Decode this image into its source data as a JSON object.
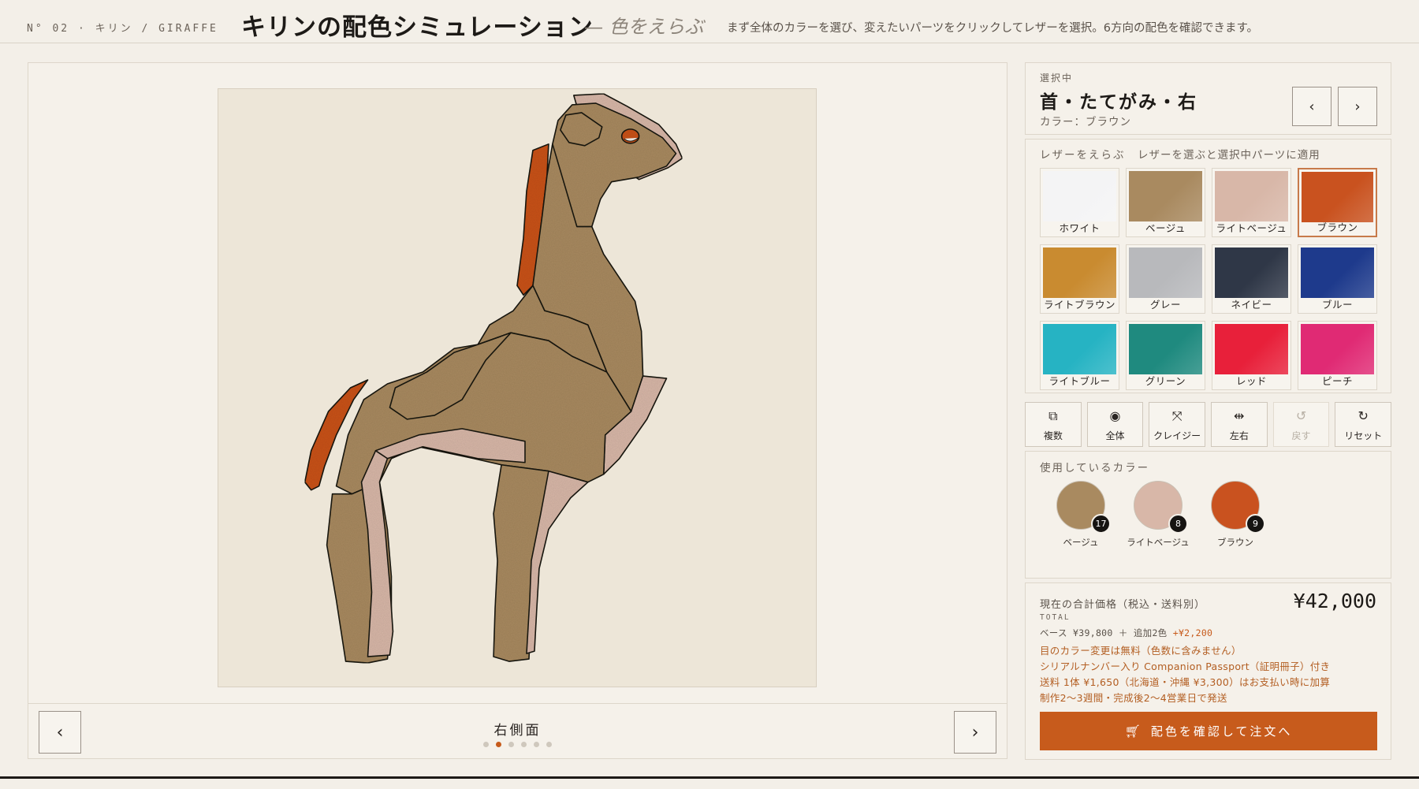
{
  "header": {
    "number": "N° 02 · キリン / GIRAFFE",
    "title": "キリンの配色シミュレーション",
    "subtitle": "— 色をえらぶ",
    "description": "まず全体のカラーを選び、変えたいパーツをクリックしてレザーを選択。6方向の配色を確認できます。"
  },
  "stage": {
    "view_label": "右側面",
    "prev_icon": "chevron-left-icon",
    "next_icon": "chevron-right-icon",
    "views_total": 6,
    "view_active_index": 1
  },
  "selection": {
    "caption": "選択中",
    "part_name": "首・たてがみ・右",
    "color_label": "カラー：ブラウン"
  },
  "leather": {
    "caption": "レザーをえらぶ",
    "hint": "レザーを選ぶと選択中パーツに適用",
    "swatches": [
      {
        "label": "ホワイト",
        "color": "#f4f4f5",
        "selected": false
      },
      {
        "label": "ベージュ",
        "color": "#a98a60",
        "selected": false
      },
      {
        "label": "ライトベージュ",
        "color": "#d8b7a8",
        "selected": false
      },
      {
        "label": "ブラウン",
        "color": "#c9521f",
        "selected": true
      },
      {
        "label": "ライトブラウン",
        "color": "#c98b30",
        "selected": false
      },
      {
        "label": "グレー",
        "color": "#b8b9bc",
        "selected": false
      },
      {
        "label": "ネイビー",
        "color": "#2f3747",
        "selected": false
      },
      {
        "label": "ブルー",
        "color": "#1e3a8c",
        "selected": false
      },
      {
        "label": "ライトブルー",
        "color": "#26b3c3",
        "selected": false
      },
      {
        "label": "グリーン",
        "color": "#1f8a7f",
        "selected": false
      },
      {
        "label": "レッド",
        "color": "#e8203a",
        "selected": false
      },
      {
        "label": "ピーチ",
        "color": "#e02a74",
        "selected": false
      }
    ]
  },
  "tools": [
    {
      "label": "複数",
      "icon": "copy-icon",
      "glyph": "⧉",
      "disabled": false
    },
    {
      "label": "全体",
      "icon": "target-icon",
      "glyph": "◉",
      "disabled": false
    },
    {
      "label": "クレイジー",
      "icon": "shuffle-icon",
      "glyph": "⤧",
      "disabled": false
    },
    {
      "label": "左右",
      "icon": "mirror-icon",
      "glyph": "⇹",
      "disabled": false
    },
    {
      "label": "戻す",
      "icon": "undo-icon",
      "glyph": "↺",
      "disabled": true
    },
    {
      "label": "リセット",
      "icon": "reset-icon",
      "glyph": "↻",
      "disabled": false
    }
  ],
  "used_colors": {
    "caption": "使用しているカラー",
    "items": [
      {
        "label": "ベージュ",
        "count": "17",
        "color": "#a98a60"
      },
      {
        "label": "ライトベージュ",
        "count": "8",
        "color": "#d8b7a8"
      },
      {
        "label": "ブラウン",
        "count": "9",
        "color": "#c9521f"
      }
    ]
  },
  "total": {
    "caption": "現在の合計価格（税込・送料別）",
    "caption_en": "TOTAL",
    "price": "¥42,000",
    "base": "ベース ¥39,800 ＋ 追加2色",
    "base_add": "+¥2,200",
    "notes": [
      "目のカラー変更は無料（色数に含みません）",
      "シリアルナンバー入り Companion Passport（証明冊子）付き",
      "送料 1体 ¥1,650（北海道・沖縄 ¥3,300）はお支払い時に加算",
      "制作2〜3週間・完成後2〜4営業日で発送"
    ],
    "order_label": "配色を確認して注文へ",
    "order_icon": "cart-icon"
  },
  "colors": {
    "accent": "#c75b1c",
    "background": "#f3efe8",
    "canvas": "#ede6d8",
    "giraffe_body": "#a98a60",
    "giraffe_light": "#d8b7a8",
    "giraffe_mane": "#c9521f"
  }
}
